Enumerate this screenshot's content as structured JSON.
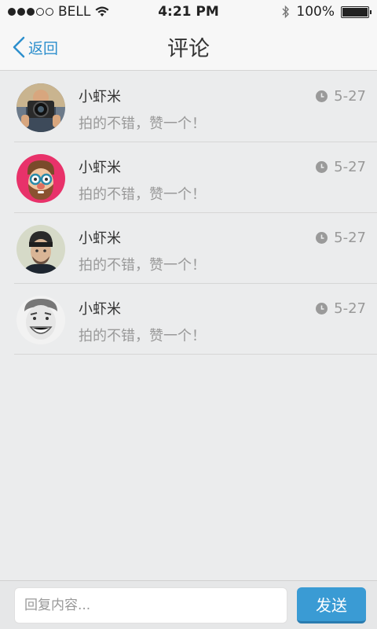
{
  "status_bar": {
    "carrier": "BELL",
    "time": "4:21 PM",
    "battery": "100%",
    "battery_level": 1.0
  },
  "nav": {
    "back_label": "返回",
    "title": "评论"
  },
  "comments": [
    {
      "name": "小虾米",
      "content": "拍的不错，赞一个！",
      "time": "5-27",
      "avatar": "photographer-avatar"
    },
    {
      "name": "小虾米",
      "content": "拍的不错，赞一个！",
      "time": "5-27",
      "avatar": "cartoon-man-avatar"
    },
    {
      "name": "小虾米",
      "content": "拍的不错，赞一个！",
      "time": "5-27",
      "avatar": "beanie-man-avatar"
    },
    {
      "name": "小虾米",
      "content": "拍的不错，赞一个！",
      "time": "5-27",
      "avatar": "smiling-man-avatar"
    }
  ],
  "reply": {
    "placeholder": "回复内容...",
    "send_label": "发送"
  },
  "colors": {
    "accent": "#3a9bd4",
    "back": "#2d8fcd"
  }
}
